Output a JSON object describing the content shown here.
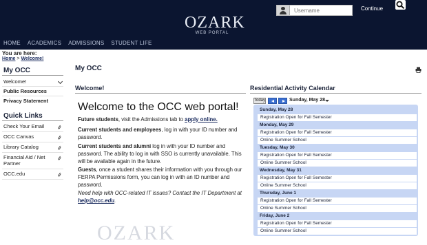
{
  "header": {
    "logo_text": "OZARK",
    "logo_subtext": "WEB PORTAL",
    "username_placeholder": "Username",
    "continue_label": "Continue",
    "nav": [
      "HOME",
      "ACADEMICS",
      "ADMISSIONS",
      "STUDENT LIFE"
    ]
  },
  "breadcrumb": {
    "you_are_here": "You are here:",
    "home": "Home",
    "separator": ">",
    "current": "Welcome!"
  },
  "sidebar": {
    "my_occ_title": "My OCC",
    "my_occ_items": [
      "Welcome!",
      "Public Resources",
      "Privacy Statement"
    ],
    "quick_links_title": "Quick Links",
    "quick_links": [
      "Check Your Email",
      "OCC Canvas",
      "Library Catalog",
      "Financial Aid / Net Partner",
      "OCC.edu"
    ]
  },
  "main": {
    "page_title": "My OCC",
    "welcome_section_title": "Welcome!",
    "welcome_heading": "Welcome to the OCC web portal!",
    "p1_bold": "Future students",
    "p1_text": ", visit the Admissions tab to ",
    "p1_link": "apply online.",
    "p2_bold": "Current students and employees",
    "p2_text": ", log in with your ID number and password.",
    "p3_bold": "Current students and alumni",
    "p3_text": " log in with your ID number and password. The ability to log in with SSO is currently unavailable. This will be available again in the future.",
    "p4_bold": "Guests",
    "p4_text": ", once a student shares their information with you through our FERPA Permissions form, you can log in with an ID number and password.",
    "p5_text": "Need help with OCC-related IT issues? Contact the IT Department at ",
    "p5_link": "help@occ.edu",
    "p5_end": ".",
    "watermark": "OZARK"
  },
  "calendar": {
    "title": "Residential Activity Calendar",
    "today_label": "Today",
    "current_date": "Sunday, May 28",
    "days": [
      {
        "label": "Sunday, May 28",
        "events": [
          "Registration Open for Fall Semester"
        ]
      },
      {
        "label": "Monday, May 29",
        "events": [
          "Registration Open for Fall Semester",
          "Online Summer School"
        ]
      },
      {
        "label": "Tuesday, May 30",
        "events": [
          "Registration Open for Fall Semester",
          "Online Summer School"
        ]
      },
      {
        "label": "Wednesday, May 31",
        "events": [
          "Registration Open for Fall Semester",
          "Online Summer School"
        ]
      },
      {
        "label": "Thursday, June 1",
        "events": [
          "Registration Open for Fall Semester",
          "Online Summer School"
        ]
      },
      {
        "label": "Friday, June 2",
        "events": [
          "Registration Open for Fall Semester",
          "Online Summer School"
        ]
      }
    ]
  },
  "icons": {
    "user": "user-icon",
    "search": "search-icon",
    "print": "print-icon",
    "chevron": "chevron-down-icon",
    "link": "paperclip-icon"
  },
  "colors": {
    "header_bg": "#0b1530",
    "calendar_bg": "#c7d6f4",
    "nav_arrow": "#3b6fd0"
  }
}
